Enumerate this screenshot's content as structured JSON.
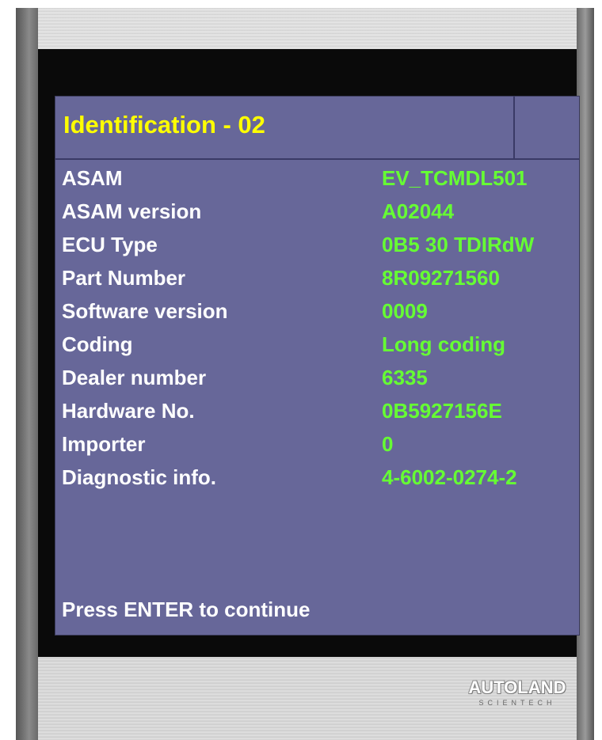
{
  "screen": {
    "title": "Identification - 02",
    "rows": [
      {
        "label": "ASAM",
        "value": "EV_TCMDL501"
      },
      {
        "label": "ASAM version",
        "value": "A02044"
      },
      {
        "label": "ECU Type",
        "value": "0B5 30 TDIRdW"
      },
      {
        "label": "Part Number",
        "value": "8R09271560"
      },
      {
        "label": "Software version",
        "value": "0009"
      },
      {
        "label": "Coding",
        "value": "Long coding"
      },
      {
        "label": "Dealer number",
        "value": "6335"
      },
      {
        "label": "Hardware No.",
        "value": "0B5927156E"
      },
      {
        "label": "Importer",
        "value": "0"
      },
      {
        "label": "Diagnostic info.",
        "value": "4-6002-0274-2"
      }
    ],
    "prompt": "Press ENTER to continue"
  },
  "brand": {
    "name": "AUTOLAND",
    "sub": "SCIENTECH"
  },
  "colors": {
    "screen_background": "#676799",
    "title_text": "#ffff00",
    "label_text": "#ffffff",
    "value_text": "#66ff33"
  }
}
